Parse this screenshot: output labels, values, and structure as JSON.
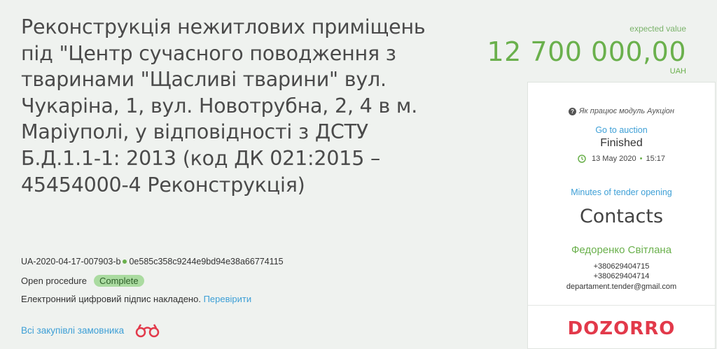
{
  "tender": {
    "title": "Реконструкція нежитлових приміщень під \"Центр сучасного поводження з тваринами \"Щасливі тварини\" вул. Чукаріна, 1, вул. Новотрубна, 2, 4 в м. Маріуполі, у відповідності з ДСТУ Б.Д.1.1-1: 2013 (код ДК 021:2015 – 45454000-4 Реконструкція)",
    "id": "UA-2020-04-17-007903-b",
    "hash": "0e585c358c9244e9bd94e38a66774115",
    "procedure": "Open procedure",
    "status": "Complete",
    "signature_text": "Електронний цифровий підпис накладено.",
    "verify_link": "Перевірити",
    "all_purchases": "Всі закупівлі замовника"
  },
  "expected": {
    "label": "expected value",
    "value": "12 700 000,00",
    "currency": "UAH"
  },
  "auction": {
    "how_label": "Як працює модуль Аукціон",
    "goto_link": "Go to auction",
    "status": "Finished",
    "date": "13 May 2020",
    "time": "15:17",
    "minutes_link": "Minutes of tender opening"
  },
  "contacts": {
    "heading": "Contacts",
    "name": "Федоренко Світлана",
    "phone1": "+380629404715",
    "phone2": "+380629404714",
    "email": "departament.tender@gmail.com"
  },
  "brand": {
    "logo": "DOZORRO"
  },
  "colors": {
    "accent_green": "#6ab04c",
    "link_blue": "#3d9fd6",
    "brand_red": "#e2394a"
  }
}
